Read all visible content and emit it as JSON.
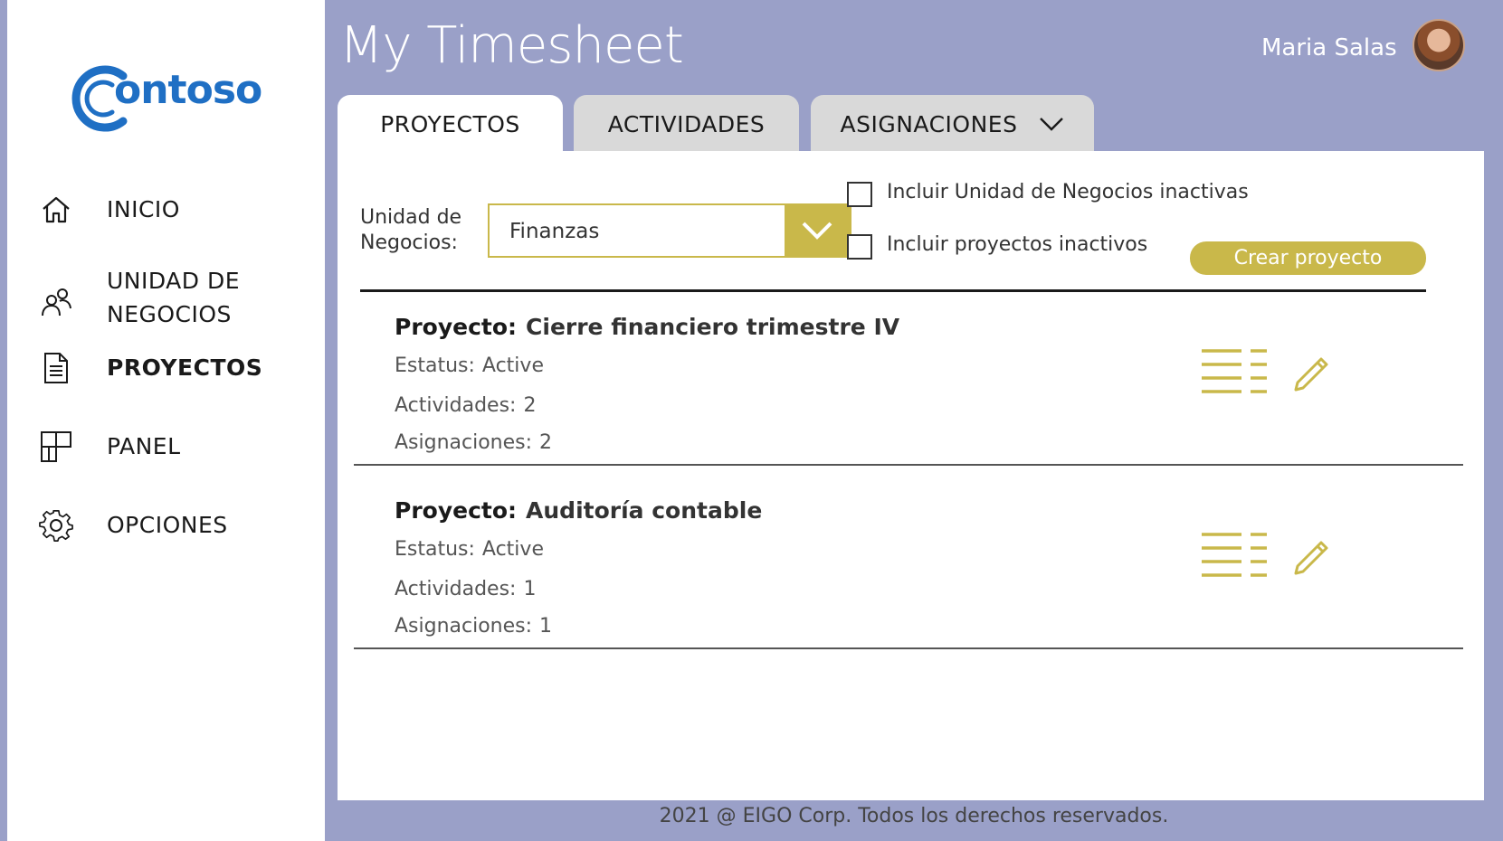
{
  "brand": {
    "logo_text": "ontoso",
    "accent": "#c9b84a",
    "header_bg": "#9aa0c8",
    "logo_color": "#1f6fc4"
  },
  "header": {
    "title": "My Timesheet",
    "user_name": "Maria Salas"
  },
  "sidebar": {
    "items": [
      {
        "label": "INICIO",
        "icon": "home-icon",
        "active": false
      },
      {
        "label": "UNIDAD DE NEGOCIOS",
        "icon": "users-icon",
        "active": false
      },
      {
        "label": "PROYECTOS",
        "icon": "document-icon",
        "active": true
      },
      {
        "label": "PANEL",
        "icon": "grid-icon",
        "active": false
      },
      {
        "label": "OPCIONES",
        "icon": "gear-icon",
        "active": false
      }
    ]
  },
  "tabs": [
    {
      "label": "PROYECTOS",
      "active": true
    },
    {
      "label": "ACTIVIDADES",
      "active": false
    },
    {
      "label": "ASIGNACIONES",
      "active": false
    }
  ],
  "filters": {
    "business_unit_label_line1": "Unidad de",
    "business_unit_label_line2": "Negocios:",
    "business_unit_value": "Finanzas",
    "include_inactive_units_label": "Incluir Unidad de Negocios inactivas",
    "include_inactive_units_checked": false,
    "include_inactive_projects_label": "Incluir proyectos inactivos",
    "include_inactive_projects_checked": false,
    "create_button": "Crear proyecto"
  },
  "projects": [
    {
      "title_label": "Proyecto:",
      "title": "Cierre financiero trimestre IV",
      "status_label": "Estatus:",
      "status": "Active",
      "activities_label": "Actividades:",
      "activities": "2",
      "assignments_label": "Asignaciones:",
      "assignments": "2"
    },
    {
      "title_label": "Proyecto:",
      "title": "Auditoría contable",
      "status_label": "Estatus:",
      "status": "Active",
      "activities_label": "Actividades:",
      "activities": "1",
      "assignments_label": "Asignaciones:",
      "assignments": "1"
    }
  ],
  "footer": {
    "text": "2021 @ EIGO Corp. Todos los derechos reservados."
  }
}
